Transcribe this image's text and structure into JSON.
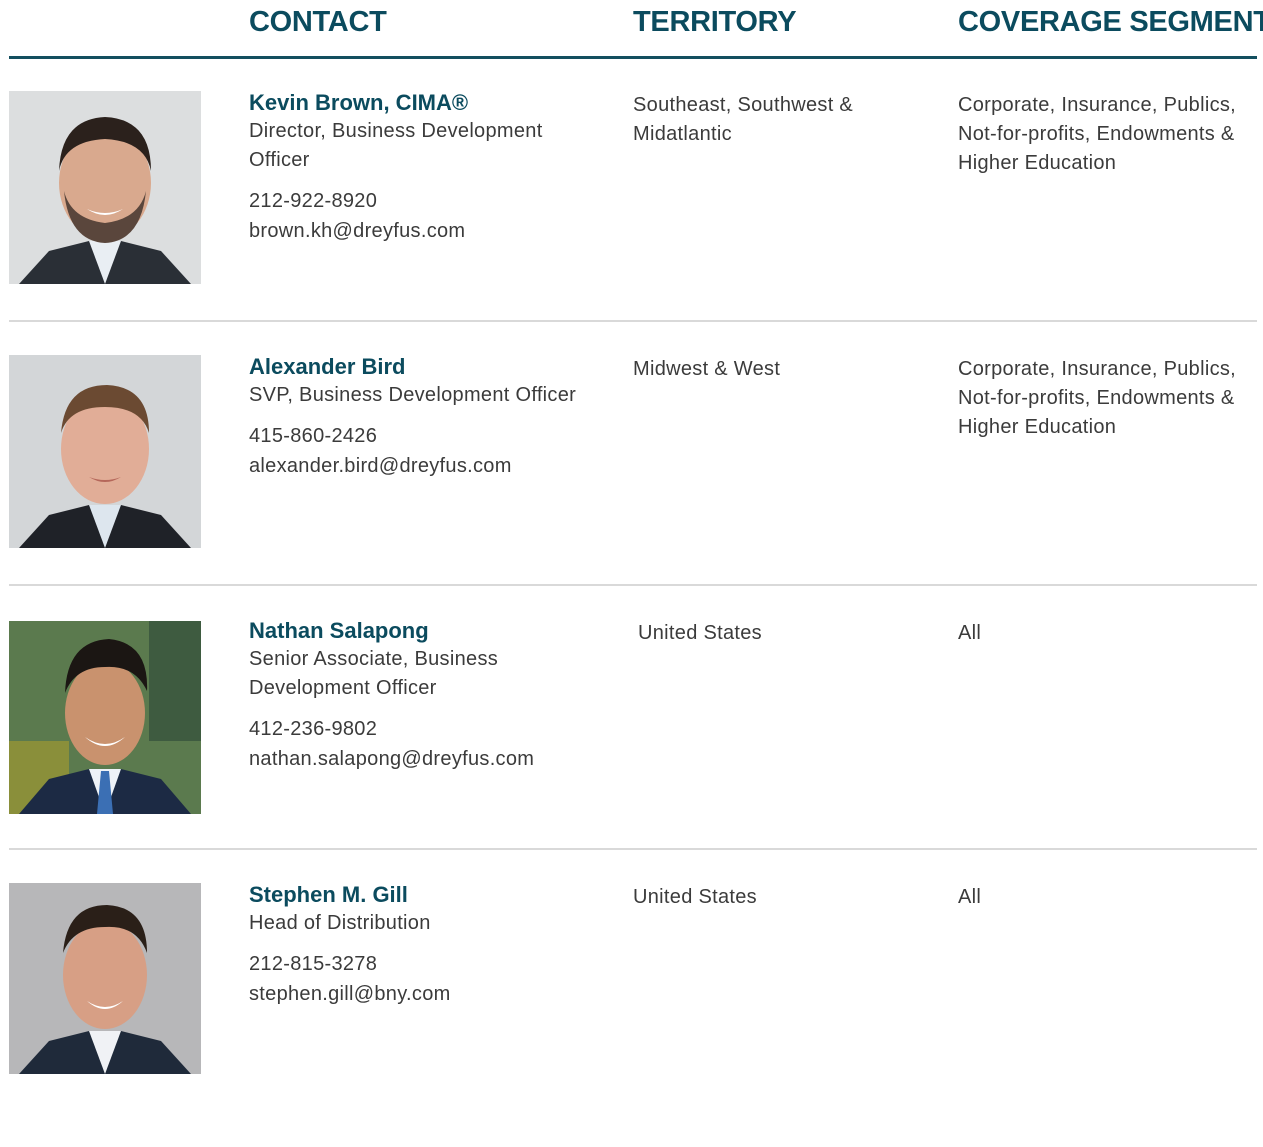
{
  "header": {
    "contact": "CONTACT",
    "territory": "TERRITORY",
    "coverage_segment": "COVERAGE SEGMENT"
  },
  "contacts": [
    {
      "name": "Kevin Brown, CIMA®",
      "title": "Director, Business Development Officer",
      "phone": "212-922-8920",
      "email": "brown.kh@dreyfus.com",
      "territory": "Southeast, Southwest & Midatlantic",
      "segment": "Corporate, Insurance, Publics, Not-for-profits, Endowments & Higher Education"
    },
    {
      "name": "Alexander Bird",
      "title": "SVP, Business Development Officer",
      "phone": "415-860-2426",
      "email": "alexander.bird@dreyfus.com",
      "territory": "Midwest & West",
      "segment": "Corporate, Insurance, Publics, Not-for-profits, Endowments & Higher Education"
    },
    {
      "name": "Nathan Salapong",
      "title": "Senior Associate, Business Development Officer",
      "phone": "412-236-9802",
      "email": "nathan.salapong@dreyfus.com",
      "territory": "United States",
      "segment": "All"
    },
    {
      "name": "Stephen M. Gill",
      "title": "Head of Distribution",
      "phone": "212-815-3278",
      "email": "stephen.gill@bny.com",
      "territory": "United States",
      "segment": "All"
    }
  ],
  "colors": {
    "heading": "#0b4b5e",
    "rule": "#134f5f",
    "divider": "#d9d9d9",
    "body_text": "#3b3b3b"
  }
}
